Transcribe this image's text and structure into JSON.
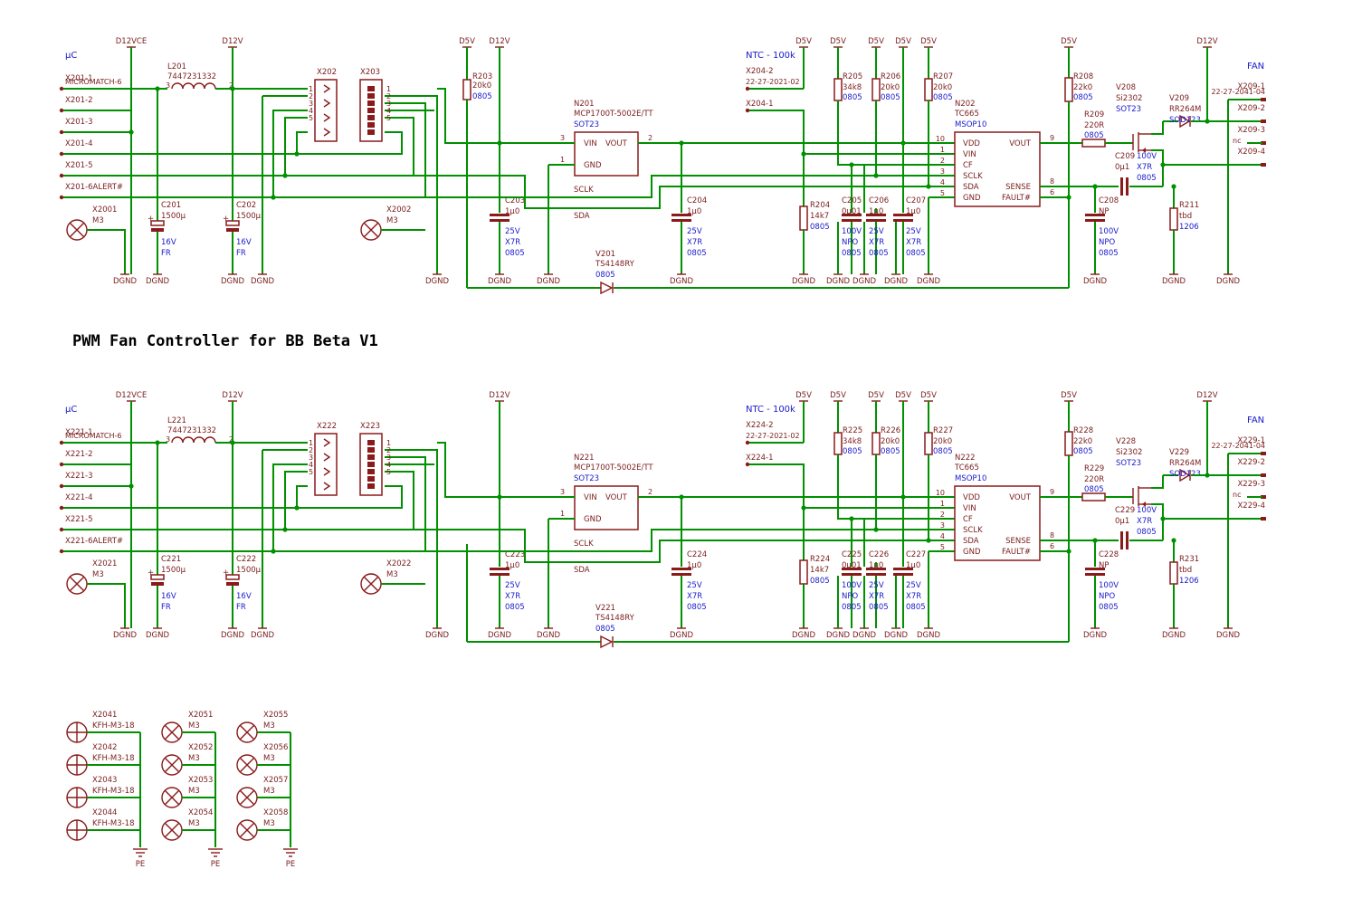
{
  "title": "PWM Fan Controller for BB Beta V1",
  "colors": {
    "wire": "#009000",
    "part": "#8b1a1a",
    "value": "#1a1acc",
    "background": "#ffffff"
  },
  "sections": [
    {
      "uc": "µC",
      "fan": "FAN",
      "ntc_label": "NTC - 100k",
      "rail_d12vce": "D12VCE",
      "rail_d12v": "D12V",
      "rail_d5v": "D5V",
      "gnd": "DGND",
      "nc": "nc",
      "conn_in": {
        "name": "X201-1",
        "type": "MICROMATCH-6",
        "pins": [
          "X201-2",
          "X201-3",
          "X201-4",
          "X201-5",
          "X201-6ALERT#"
        ]
      },
      "L": {
        "ref": "L201",
        "val": "7447231332",
        "p1": "3",
        "p2": "2"
      },
      "mount_left": {
        "ref": "X2001",
        "val": "M3"
      },
      "C_left1": {
        "ref": "C201",
        "val": "1500µ",
        "v": "16V",
        "t": "FR"
      },
      "C_left2": {
        "ref": "C202",
        "val": "1500µ",
        "v": "16V",
        "t": "FR"
      },
      "hdrA": {
        "ref": "X202",
        "pins": [
          "1",
          "2",
          "3",
          "4",
          "5"
        ]
      },
      "hdrB": {
        "ref": "X203",
        "pins": [
          "1",
          "2",
          "3",
          "4",
          "5"
        ]
      },
      "mount_mid": {
        "ref": "X2002",
        "val": "M3"
      },
      "R203": {
        "ref": "R203",
        "val": "20k0",
        "pkg": "0805"
      },
      "C203": {
        "ref": "C203",
        "val": "1µ0",
        "v": "25V",
        "t": "X7R",
        "pkg": "0805"
      },
      "reg": {
        "ref": "N201",
        "part": "MCP1700T-5002E/TT",
        "pkg": "SOT23",
        "vin": "VIN",
        "vout": "VOUT",
        "gnd": "GND",
        "pin_vin": "3",
        "pin_vout": "2",
        "pin_gnd": "1"
      },
      "C204": {
        "ref": "C204",
        "val": "1µ0",
        "v": "25V",
        "t": "X7R",
        "pkg": "0805"
      },
      "sclk": "SCLK",
      "sda": "SDA",
      "diode": {
        "ref": "V201",
        "part": "TS4148RY",
        "pkg": "0805"
      },
      "ntc_conn": {
        "p2": "X204-2",
        "type": "22-27-2021-02",
        "p1": "X204-1"
      },
      "R204": {
        "ref": "R204",
        "val": "14k7",
        "pkg": "0805"
      },
      "R205": {
        "ref": "R205",
        "val": "34k8",
        "pkg": "0805"
      },
      "R206": {
        "ref": "R206",
        "val": "20k0",
        "pkg": "0805"
      },
      "R207": {
        "ref": "R207",
        "val": "20k0",
        "pkg": "0805"
      },
      "C205": {
        "ref": "C205",
        "val": "0µ01",
        "v": "100V",
        "t": "NPO",
        "pkg": "0805"
      },
      "C206": {
        "ref": "C206",
        "val": "1µ0",
        "v": "25V",
        "t": "X7R",
        "pkg": "0805"
      },
      "C207": {
        "ref": "C207",
        "val": "1µ0",
        "v": "25V",
        "t": "X7R",
        "pkg": "0805"
      },
      "ic": {
        "ref": "N202",
        "part": "TC665",
        "pkg": "MSOP10",
        "l": [
          "VDD",
          "VIN",
          "CF",
          "SCLK",
          "SDA",
          "GND"
        ],
        "lp": [
          "10",
          "1",
          "2",
          "3",
          "4",
          "5"
        ],
        "r": [
          "VOUT",
          "SENSE",
          "FAULT#"
        ],
        "rp": [
          "9",
          "8",
          "6"
        ]
      },
      "R208": {
        "ref": "R208",
        "val": "22k0",
        "pkg": "0805"
      },
      "R209": {
        "ref": "R209",
        "val": "220R",
        "pkg": "0805"
      },
      "C208": {
        "ref": "C208",
        "val": "NP",
        "v": "100V",
        "t": "NPO",
        "pkg": "0805"
      },
      "C209": {
        "ref": "C209",
        "val": "0µ1",
        "v": "100V",
        "t": "X7R",
        "pkg": "0805"
      },
      "fet": {
        "ref": "V208",
        "part": "Si2302",
        "pkg": "SOT23"
      },
      "schottky": {
        "ref": "V209",
        "part": "RR264M",
        "pkg": "SOD123"
      },
      "R211": {
        "ref": "R211",
        "val": "tbd",
        "pkg": "1206"
      },
      "fan_conn": {
        "p1": "X209-1",
        "type": "22-27-2041-04",
        "p2": "X209-2",
        "p3": "X209-3",
        "p4": "X209-4"
      }
    },
    {
      "uc": "µC",
      "fan": "FAN",
      "ntc_label": "NTC - 100k",
      "rail_d12vce": "D12VCE",
      "rail_d12v": "D12V",
      "rail_d5v": "D5V",
      "gnd": "DGND",
      "nc": "nc",
      "conn_in": {
        "name": "X221-1",
        "type": "MICROMATCH-6",
        "pins": [
          "X221-2",
          "X221-3",
          "X221-4",
          "X221-5",
          "X221-6ALERT#"
        ]
      },
      "L": {
        "ref": "L221",
        "val": "7447231332",
        "p1": "3",
        "p2": "2"
      },
      "mount_left": {
        "ref": "X2021",
        "val": "M3"
      },
      "C_left1": {
        "ref": "C221",
        "val": "1500µ",
        "v": "16V",
        "t": "FR"
      },
      "C_left2": {
        "ref": "C222",
        "val": "1500µ",
        "v": "16V",
        "t": "FR"
      },
      "hdrA": {
        "ref": "X222",
        "pins": [
          "1",
          "2",
          "3",
          "4",
          "5"
        ]
      },
      "hdrB": {
        "ref": "X223",
        "pins": [
          "1",
          "2",
          "3",
          "4",
          "5"
        ]
      },
      "mount_mid": {
        "ref": "X2022",
        "val": "M3"
      },
      "R203": {
        "ref": "",
        "val": "",
        "pkg": ""
      },
      "C203": {
        "ref": "C223",
        "val": "1µ0",
        "v": "25V",
        "t": "X7R",
        "pkg": "0805"
      },
      "reg": {
        "ref": "N221",
        "part": "MCP1700T-5002E/TT",
        "pkg": "SOT23",
        "vin": "VIN",
        "vout": "VOUT",
        "gnd": "GND",
        "pin_vin": "3",
        "pin_vout": "2",
        "pin_gnd": "1"
      },
      "C204": {
        "ref": "C224",
        "val": "1µ0",
        "v": "25V",
        "t": "X7R",
        "pkg": "0805"
      },
      "sclk": "SCLK",
      "sda": "SDA",
      "diode": {
        "ref": "V221",
        "part": "TS4148RY",
        "pkg": "0805"
      },
      "ntc_conn": {
        "p2": "X224-2",
        "type": "22-27-2021-02",
        "p1": "X224-1"
      },
      "R204": {
        "ref": "R224",
        "val": "14k7",
        "pkg": "0805"
      },
      "R205": {
        "ref": "R225",
        "val": "34k8",
        "pkg": "0805"
      },
      "R206": {
        "ref": "R226",
        "val": "20k0",
        "pkg": "0805"
      },
      "R207": {
        "ref": "R227",
        "val": "20k0",
        "pkg": "0805"
      },
      "C205": {
        "ref": "C225",
        "val": "0µ01",
        "v": "100V",
        "t": "NPO",
        "pkg": "0805"
      },
      "C206": {
        "ref": "C226",
        "val": "1µ0",
        "v": "25V",
        "t": "X7R",
        "pkg": "0805"
      },
      "C207": {
        "ref": "C227",
        "val": "1µ0",
        "v": "25V",
        "t": "X7R",
        "pkg": "0805"
      },
      "ic": {
        "ref": "N222",
        "part": "TC665",
        "pkg": "MSOP10",
        "l": [
          "VDD",
          "VIN",
          "CF",
          "SCLK",
          "SDA",
          "GND"
        ],
        "lp": [
          "10",
          "1",
          "2",
          "3",
          "4",
          "5"
        ],
        "r": [
          "VOUT",
          "SENSE",
          "FAULT#"
        ],
        "rp": [
          "9",
          "8",
          "6"
        ]
      },
      "R208": {
        "ref": "R228",
        "val": "22k0",
        "pkg": "0805"
      },
      "R209": {
        "ref": "R229",
        "val": "220R",
        "pkg": "0805"
      },
      "C208": {
        "ref": "C228",
        "val": "NP",
        "v": "100V",
        "t": "NPO",
        "pkg": "0805"
      },
      "C209": {
        "ref": "C229",
        "val": "0µ1",
        "v": "100V",
        "t": "X7R",
        "pkg": "0805"
      },
      "fet": {
        "ref": "V228",
        "part": "Si2302",
        "pkg": "SOT23"
      },
      "schottky": {
        "ref": "V229",
        "part": "RR264M",
        "pkg": "SOD123"
      },
      "R211": {
        "ref": "R231",
        "val": "tbd",
        "pkg": "1206"
      },
      "fan_conn": {
        "p1": "X229-1",
        "type": "22-27-2041-04",
        "p2": "X229-2",
        "p3": "X229-3",
        "p4": "X229-4"
      }
    }
  ],
  "mounting": {
    "pe": "PE",
    "fhk": [
      {
        "ref": "X2041",
        "val": "KFH-M3-18"
      },
      {
        "ref": "X2042",
        "val": "KFH-M3-18"
      },
      {
        "ref": "X2043",
        "val": "KFH-M3-18"
      },
      {
        "ref": "X2044",
        "val": "KFH-M3-18"
      }
    ],
    "colA": [
      {
        "ref": "X2051",
        "val": "M3"
      },
      {
        "ref": "X2052",
        "val": "M3"
      },
      {
        "ref": "X2053",
        "val": "M3"
      },
      {
        "ref": "X2054",
        "val": "M3"
      }
    ],
    "colB": [
      {
        "ref": "X2055",
        "val": "M3"
      },
      {
        "ref": "X2056",
        "val": "M3"
      },
      {
        "ref": "X2057",
        "val": "M3"
      },
      {
        "ref": "X2058",
        "val": "M3"
      }
    ]
  }
}
